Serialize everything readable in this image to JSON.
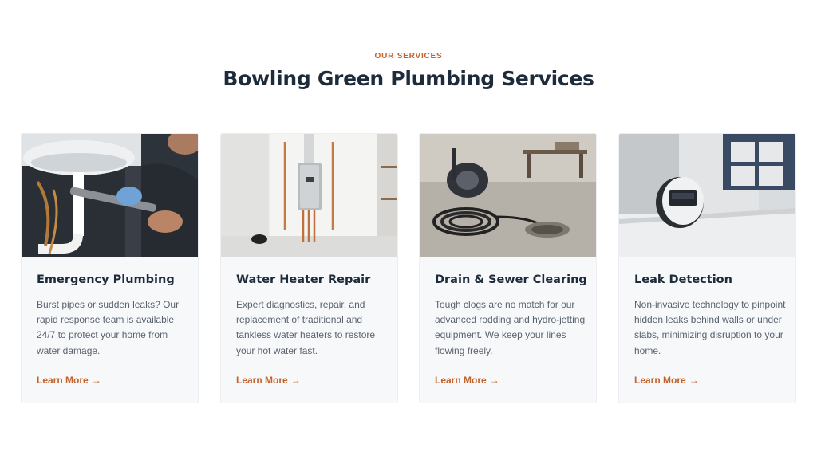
{
  "section": {
    "eyebrow": "OUR SERVICES",
    "title": "Bowling Green Plumbing Services"
  },
  "colors": {
    "accent": "#c2622d",
    "heading": "#1e2b3b",
    "body_text": "#59636f",
    "card_bg": "#f7f8f9"
  },
  "cards": [
    {
      "title": "Emergency Plumbing",
      "description": "Burst pipes or sudden leaks? Our rapid response team is available 24/7 to protect your home from water damage.",
      "link_label": "Learn More",
      "link_icon": "arrow-right-icon",
      "image": "plumber-wrench-photo"
    },
    {
      "title": "Water Heater Repair",
      "description": "Expert diagnostics, repair, and replacement of traditional and tankless water heaters to restore your hot water fast.",
      "link_label": "Learn More",
      "link_icon": "arrow-right-icon",
      "image": "tankless-water-heater-photo"
    },
    {
      "title": "Drain & Sewer Clearing",
      "description": "Tough clogs are no match for our advanced rodding and hydro-jetting equipment. We keep your lines flowing freely.",
      "link_label": "Learn More",
      "link_icon": "arrow-right-icon",
      "image": "drain-machine-photo"
    },
    {
      "title": "Leak Detection",
      "description": "Non-invasive technology to pinpoint hidden leaks behind walls or under slabs, minimizing disruption to your home.",
      "link_label": "Learn More",
      "link_icon": "arrow-right-icon",
      "image": "leak-sensor-photo"
    }
  ]
}
